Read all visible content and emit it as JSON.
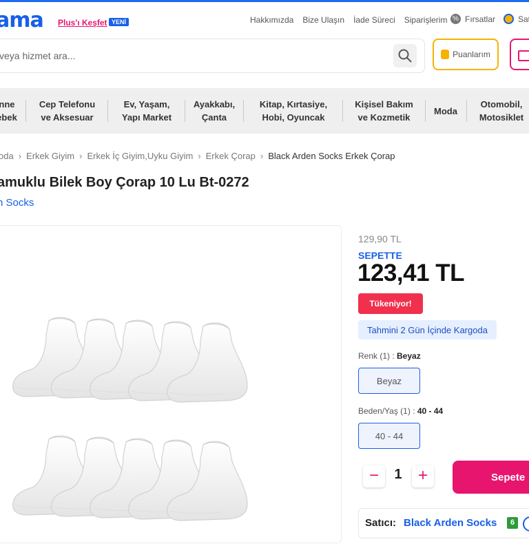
{
  "header": {
    "logo": "ama",
    "plus_link": "Plus'ı Keşfet",
    "plus_badge": "YENİ",
    "links": [
      "Hakkımızda",
      "Bize Ulaşın",
      "İade Süreci",
      "Siparişlerim"
    ],
    "firsatlar": "Fırsatlar",
    "sat": "Sat"
  },
  "search": {
    "placeholder": "veya hizmet ara..."
  },
  "points_button": "Puanlarım",
  "categories": [
    [
      "nne",
      "ebek"
    ],
    [
      "Cep Telefonu",
      "ve Aksesuar"
    ],
    [
      "Ev, Yaşam,",
      "Yapı Market"
    ],
    [
      "Ayakkabı,",
      "Çanta"
    ],
    [
      "Kitap, Kırtasiye,",
      "Hobi, Oyuncak"
    ],
    [
      "Kişisel Bakım",
      "ve Kozmetik"
    ],
    [
      "Moda"
    ],
    [
      "Otomobil,",
      "Motosiklet"
    ]
  ],
  "breadcrumb": [
    "oda",
    "Erkek Giyim",
    "Erkek İç Giyim,Uyku Giyim",
    "Erkek Çorap",
    "Black Arden Socks Erkek Çorap"
  ],
  "product": {
    "title": "amuklu Bilek Boy Çorap 10 Lu Bt-0272",
    "brand": "n Socks",
    "old_price": "129,90 TL",
    "sepette_label": "SEPETTE",
    "price": "123,41 TL",
    "stock_badge": "Tükeniyor!",
    "shipping": "Tahmini 2 Gün İçinde Kargoda",
    "color_label": "Renk (1) : ",
    "color_value": "Beyaz",
    "color_option": "Beyaz",
    "size_label": "Beden/Yaş (1) : ",
    "size_value": "40 - 44",
    "size_option": "40 - 44",
    "quantity": "1",
    "add_to_cart": "Sepete",
    "seller_label": "Satıcı:",
    "seller_name": "Black Arden Socks",
    "seller_score": "6"
  },
  "colors": {
    "brand_blue": "#1760e8",
    "accent_pink": "#e8156f",
    "badge_red": "#f0304c",
    "gold": "#f5b301"
  }
}
